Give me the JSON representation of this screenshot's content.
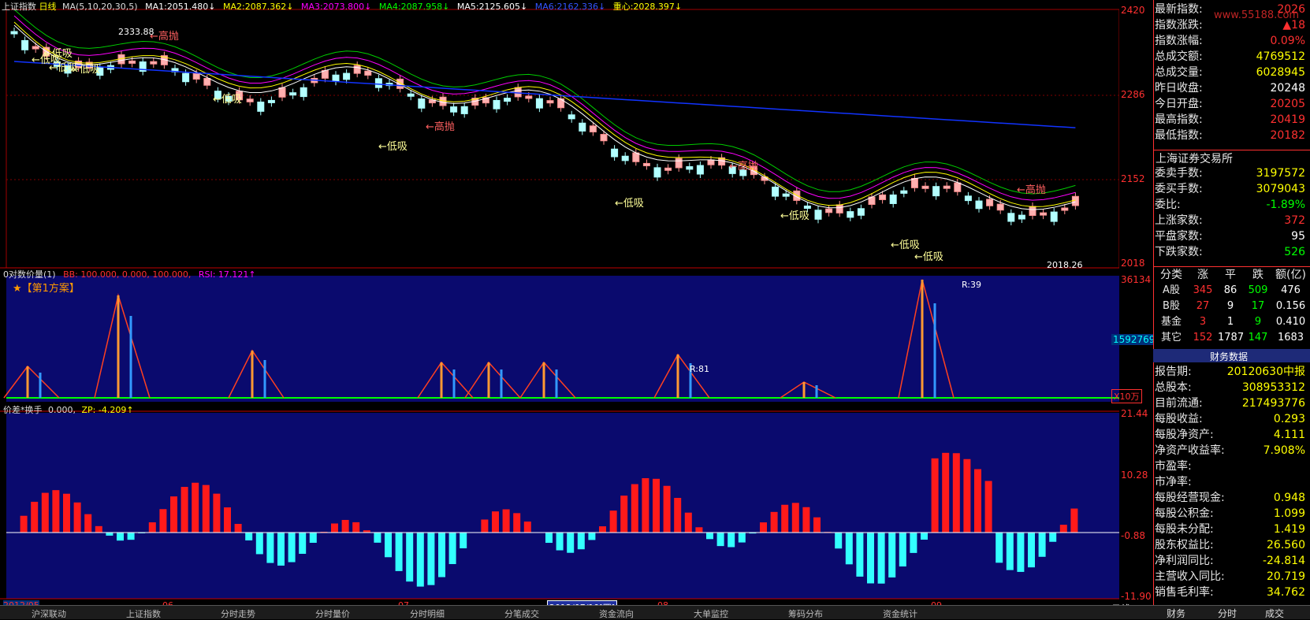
{
  "header": {
    "index_name": "上证指数",
    "period": "日线",
    "ma_params": "MA(5,10,20,30,5)",
    "ma1_label": "MA1:",
    "ma1_value": "2051.480↓",
    "ma2_label": "MA2:",
    "ma2_value": "2087.362↓",
    "ma3_label": "MA3:",
    "ma3_value": "2073.800↓",
    "ma4_label": "MA4:",
    "ma4_value": "2087.958↓",
    "ma5_label": "MA5:",
    "ma5_value": "2125.605↓",
    "ma6_label": "MA6:",
    "ma6_value": "2162.336↓",
    "center_label": "重心:",
    "center_value": "2028.397↓",
    "colors": {
      "ma1": "#ffffff",
      "ma2": "#ffff00",
      "ma3": "#ff00ff",
      "ma4": "#00ff00",
      "ma5": "#ffffff",
      "ma6": "#0000ff",
      "center": "#ffff00"
    }
  },
  "price_axis": [
    "2420",
    "2286",
    "2152",
    "2018"
  ],
  "price_labels": {
    "high_price": "2333.88",
    "low_price": "2018.26",
    "signals_low": [
      "低吸",
      "低吸",
      "低吸",
      "低吸",
      "低吸",
      "低吸",
      "低吸",
      "低吸",
      "低吸",
      "低吸"
    ],
    "signals_high": [
      "高抛",
      "高抛",
      "高抛",
      "高抛"
    ]
  },
  "vol_panel": {
    "title": "0对数价量(1)",
    "bb_label": "BB: 100.000, 0.000, 100.000,",
    "rsi_label": "RSI: 17.121↑",
    "scheme": "★【第1方案】",
    "ratio_label_1": "R:39",
    "ratio_label_2": "R:81",
    "axis_top": "36134",
    "axis_badge": "1592769",
    "axis_unit": "X10万"
  },
  "diff_panel": {
    "title": "价差*换手",
    "value": "0.000,",
    "zp_label": "ZP: -4.209↑",
    "axis": [
      "21.44",
      "10.28",
      "-0.88",
      "-11.90"
    ]
  },
  "date_axis": {
    "labels": [
      "2012/05",
      "06",
      "07",
      "08",
      "09"
    ],
    "cursor_date": "2012/07/19",
    "cursor_weekday": "四",
    "period": "日线"
  },
  "quote_panel": {
    "rows": [
      {
        "k": "最新指数:",
        "v": "2026"
      },
      {
        "k": "指数涨跌:",
        "v": "▲18"
      },
      {
        "k": "指数涨幅:",
        "v": "0.09%"
      },
      {
        "k": "总成交额:",
        "v": "4769512"
      },
      {
        "k": "总成交量:",
        "v": "6028945"
      },
      {
        "k": "昨日收盘:",
        "v": "20248"
      },
      {
        "k": "今日开盘:",
        "v": "20205"
      },
      {
        "k": "最高指数:",
        "v": "20419"
      },
      {
        "k": "最低指数:",
        "v": "20182"
      }
    ],
    "watermark": "www.55188.com",
    "exchange_title": "上海证券交易所",
    "exchange_rows": [
      {
        "k": "委卖手数:",
        "v": "3197572"
      },
      {
        "k": "委买手数:",
        "v": "3079043"
      },
      {
        "k": "委比:",
        "v": "-1.89%"
      },
      {
        "k": "上涨家数:",
        "v": "372"
      },
      {
        "k": "平盘家数:",
        "v": "95"
      },
      {
        "k": "下跌家数:",
        "v": "526"
      }
    ],
    "breadth_headers": [
      "分类",
      "涨",
      "平",
      "跌",
      "额(亿)"
    ],
    "breadth_rows": [
      {
        "name": "A股",
        "up": "345",
        "flat": "86",
        "down": "509",
        "amt": "476"
      },
      {
        "name": "B股",
        "up": "27",
        "flat": "9",
        "down": "17",
        "amt": "0.156"
      },
      {
        "name": "基金",
        "up": "3",
        "flat": "1",
        "down": "9",
        "amt": "0.410"
      },
      {
        "name": "其它",
        "up": "152",
        "flat": "1787",
        "down": "147",
        "amt": "1683"
      }
    ],
    "finance_title": "财务数据",
    "finance_rows": [
      {
        "k": "报告期:",
        "v": "20120630中报"
      },
      {
        "k": "总股本:",
        "v": "308953312"
      },
      {
        "k": "目前流通:",
        "v": "217493776"
      },
      {
        "k": "每股收益:",
        "v": "0.293"
      },
      {
        "k": "每股净资产:",
        "v": "4.111"
      },
      {
        "k": "净资产收益率:",
        "v": "7.908%"
      },
      {
        "k": "市盈率:",
        "v": ""
      },
      {
        "k": "市净率:",
        "v": ""
      },
      {
        "k": "每股经营现金:",
        "v": "0.948"
      },
      {
        "k": "每股公积金:",
        "v": "1.099"
      },
      {
        "k": "每股未分配:",
        "v": "1.419"
      },
      {
        "k": "股东权益比:",
        "v": "26.560"
      },
      {
        "k": "净利润同比:",
        "v": "-24.814"
      },
      {
        "k": "主营收入同比:",
        "v": "20.719"
      },
      {
        "k": "销售毛利率:",
        "v": "34.762"
      }
    ]
  },
  "tabs": [
    "财务",
    "分时",
    "成交"
  ],
  "status_items": [
    "沪深联动",
    "上证指数",
    "分时走势",
    "分时量价",
    "分时明细",
    "分笔成交",
    "资金流向",
    "大单监控",
    "筹码分布",
    "资金统计"
  ]
}
